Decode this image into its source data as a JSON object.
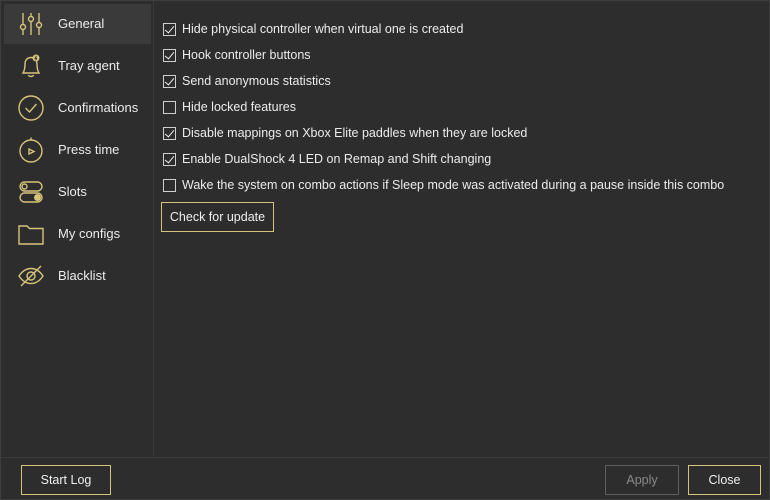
{
  "sidebar": {
    "items": [
      {
        "label": "General",
        "icon": "sliders-icon",
        "active": true
      },
      {
        "label": "Tray agent",
        "icon": "bell-icon",
        "active": false
      },
      {
        "label": "Confirmations",
        "icon": "check-circle-icon",
        "active": false
      },
      {
        "label": "Press time",
        "icon": "stopwatch-icon",
        "active": false
      },
      {
        "label": "Slots",
        "icon": "toggle-icon",
        "active": false
      },
      {
        "label": "My configs",
        "icon": "folder-icon",
        "active": false
      },
      {
        "label": "Blacklist",
        "icon": "eye-off-icon",
        "active": false
      }
    ]
  },
  "options": [
    {
      "label": "Hide physical controller when virtual one is created",
      "checked": true
    },
    {
      "label": "Hook controller buttons",
      "checked": true
    },
    {
      "label": "Send anonymous statistics",
      "checked": true
    },
    {
      "label": "Hide locked features",
      "checked": false
    },
    {
      "label": "Disable mappings on Xbox Elite paddles when they are locked",
      "checked": true
    },
    {
      "label": "Enable DualShock 4 LED on Remap and Shift changing",
      "checked": true
    },
    {
      "label": "Wake the system on combo actions if Sleep mode was activated during a pause inside this combo",
      "checked": false
    }
  ],
  "buttons": {
    "check_update": "Check for update",
    "start_log": "Start Log",
    "apply": "Apply",
    "close": "Close"
  },
  "colors": {
    "accent": "#d6c47a",
    "background": "#2d2d2d",
    "active_item": "#3a3a3a"
  }
}
